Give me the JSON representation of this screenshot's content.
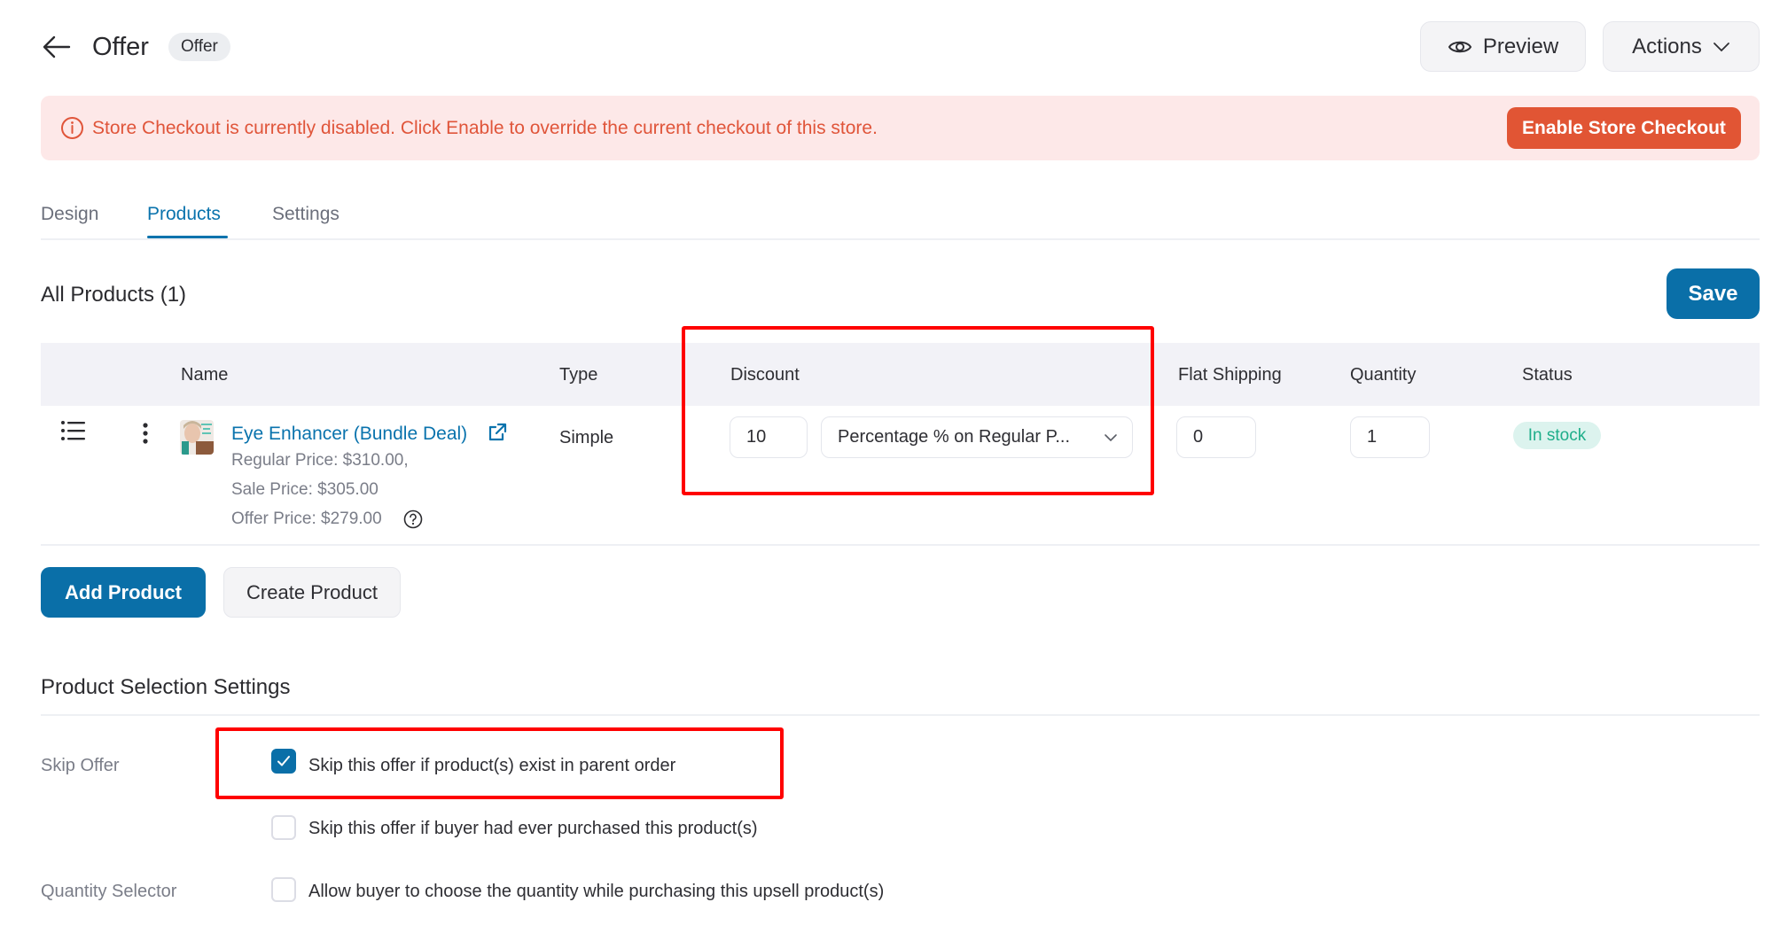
{
  "header": {
    "title": "Offer",
    "badge": "Offer",
    "preview_label": "Preview",
    "actions_label": "Actions"
  },
  "banner": {
    "message": "Store Checkout is currently disabled. Click Enable to override the current checkout of this store.",
    "button_label": "Enable Store Checkout",
    "color": "#e0553a"
  },
  "tabs": [
    {
      "label": "Design",
      "active": false
    },
    {
      "label": "Products",
      "active": true
    },
    {
      "label": "Settings",
      "active": false
    }
  ],
  "products": {
    "title": "All Products (1)",
    "save_label": "Save",
    "columns": [
      "Name",
      "Type",
      "Discount",
      "Flat Shipping",
      "Quantity",
      "Status"
    ],
    "rows": [
      {
        "name": "Eye Enhancer (Bundle Deal)",
        "regular_price": "Regular Price: $310.00,",
        "sale_price": "Sale Price: $305.00",
        "offer_price": "Offer Price: $279.00",
        "type": "Simple",
        "discount_value": "10",
        "discount_type": "Percentage % on Regular P...",
        "flat_shipping": "0",
        "quantity": "1",
        "status": "In stock"
      }
    ],
    "add_label": "Add Product",
    "create_label": "Create Product"
  },
  "selection_settings": {
    "title": "Product Selection Settings",
    "skip_offer_label": "Skip Offer",
    "quantity_selector_label": "Quantity Selector",
    "options": [
      {
        "label": "Skip this offer if product(s) exist in parent order",
        "checked": true
      },
      {
        "label": "Skip this offer if buyer had ever purchased this product(s)",
        "checked": false
      },
      {
        "label": "Allow buyer to choose the quantity while purchasing this upsell product(s)",
        "checked": false
      }
    ]
  },
  "colors": {
    "primary": "#0a6fa8",
    "danger": "#e15534",
    "success": "#1fae8a",
    "highlight": "#ff0000"
  }
}
